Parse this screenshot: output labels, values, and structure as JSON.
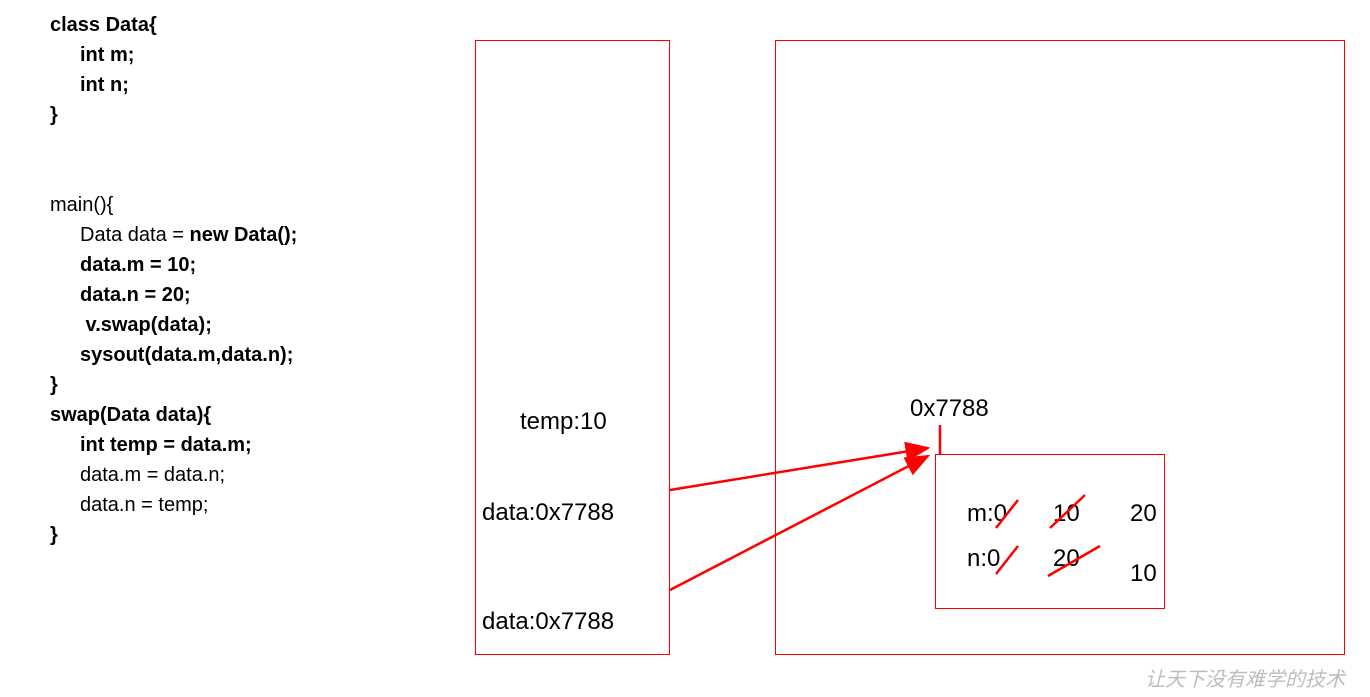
{
  "code": {
    "class_decl": "class Data{",
    "field_m": "int m;",
    "field_n": "int n;",
    "class_close": "}",
    "main_decl": "main(){",
    "main_l1a": "Data data = ",
    "main_l1b": "new Data();",
    "main_l2": "data.m = 10;",
    "main_l3": "data.n = 20;",
    "main_l4": " v.swap(data);",
    "main_l5": "sysout(data.m,data.n);",
    "main_close": "}",
    "swap_decl": "swap(Data data){",
    "swap_l1": "int temp = data.m;",
    "swap_l2": "data.m = data.n;",
    "swap_l3": "data.n = temp;",
    "swap_close": "}"
  },
  "stack": {
    "temp": "temp:10",
    "data1": "data:0x7788",
    "data2": "data:0x7788"
  },
  "heap": {
    "address": "0x7788",
    "m_label": "m:0",
    "m_old": "10",
    "m_new": "20",
    "n_label": "n:0",
    "n_old": "20",
    "n_new": "10"
  },
  "watermark": "让天下没有难学的技术"
}
